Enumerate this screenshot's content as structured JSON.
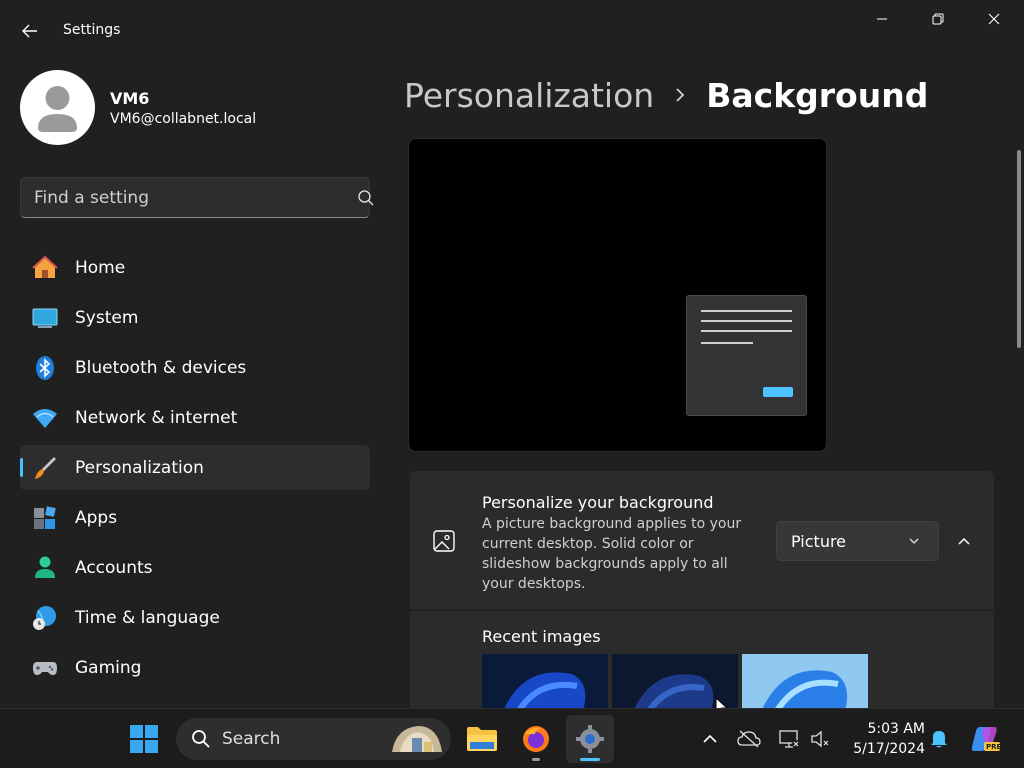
{
  "window": {
    "title": "Settings",
    "controls": {
      "minimize": "minimize",
      "maximize": "restore",
      "close": "close"
    }
  },
  "profile": {
    "name": "VM6",
    "email": "VM6@collabnet.local"
  },
  "search": {
    "placeholder": "Find a setting"
  },
  "nav": {
    "items": [
      {
        "label": "Home",
        "icon": "home-icon",
        "active": false
      },
      {
        "label": "System",
        "icon": "system-icon",
        "active": false
      },
      {
        "label": "Bluetooth & devices",
        "icon": "bluetooth-icon",
        "active": false
      },
      {
        "label": "Network & internet",
        "icon": "wifi-icon",
        "active": false
      },
      {
        "label": "Personalization",
        "icon": "brush-icon",
        "active": true
      },
      {
        "label": "Apps",
        "icon": "apps-icon",
        "active": false
      },
      {
        "label": "Accounts",
        "icon": "accounts-icon",
        "active": false
      },
      {
        "label": "Time & language",
        "icon": "globe-clock-icon",
        "active": false
      },
      {
        "label": "Gaming",
        "icon": "gamepad-icon",
        "active": false
      }
    ]
  },
  "breadcrumb": {
    "parent": "Personalization",
    "current": "Background"
  },
  "background_card": {
    "title": "Personalize your background",
    "description": "A picture background applies to your current desktop. Solid color or slideshow backgrounds apply to all your desktops.",
    "dropdown_value": "Picture",
    "expanded": true
  },
  "recent_images": {
    "label": "Recent images",
    "count_visible": 3
  },
  "taskbar": {
    "search_label": "Search",
    "apps": [
      "start",
      "search",
      "file-explorer",
      "firefox",
      "settings"
    ],
    "clock_time": "5:03 AM",
    "clock_date": "5/17/2024",
    "copilot_badge": "PRE"
  },
  "colors": {
    "accent": "#4cc2ff",
    "background": "#202020",
    "card": "#2b2b2b"
  }
}
